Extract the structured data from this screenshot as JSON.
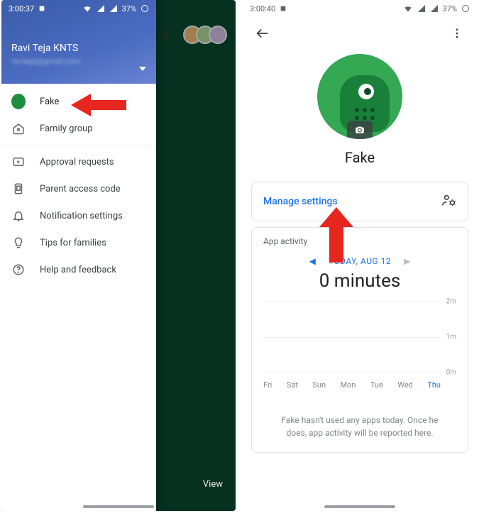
{
  "left": {
    "status": {
      "time": "3:00:37",
      "battery": "37%"
    },
    "header": {
      "account_name": "Ravi Teja KNTS",
      "account_email_redacted": "raviteja@gmail.com"
    },
    "drawer_items": {
      "child": "Fake",
      "family": "Family group",
      "approvals": "Approval requests",
      "access_code": "Parent access code",
      "notifications": "Notification settings",
      "tips": "Tips for families",
      "help": "Help and feedback"
    },
    "view_label": "View"
  },
  "right": {
    "status": {
      "time": "3:00:40",
      "battery": "37%"
    },
    "profile": {
      "name": "Fake"
    },
    "settings_link": "Manage settings",
    "activity": {
      "title": "App activity",
      "date_label": "TODAY, AUG 12",
      "minutes_label": "0 minutes",
      "empty_msg": "Fake hasn't used any apps today. Once he does, app activity will be reported here."
    }
  },
  "chart_data": {
    "type": "bar",
    "categories": [
      "Fri",
      "Sat",
      "Sun",
      "Mon",
      "Tue",
      "Wed",
      "Thu"
    ],
    "values": [
      0,
      0,
      0,
      0,
      0,
      0,
      0
    ],
    "ylabel": "minutes",
    "ylim": [
      0,
      2
    ],
    "ticks": [
      "0m",
      "1m",
      "2m"
    ],
    "active_day": "Thu"
  }
}
